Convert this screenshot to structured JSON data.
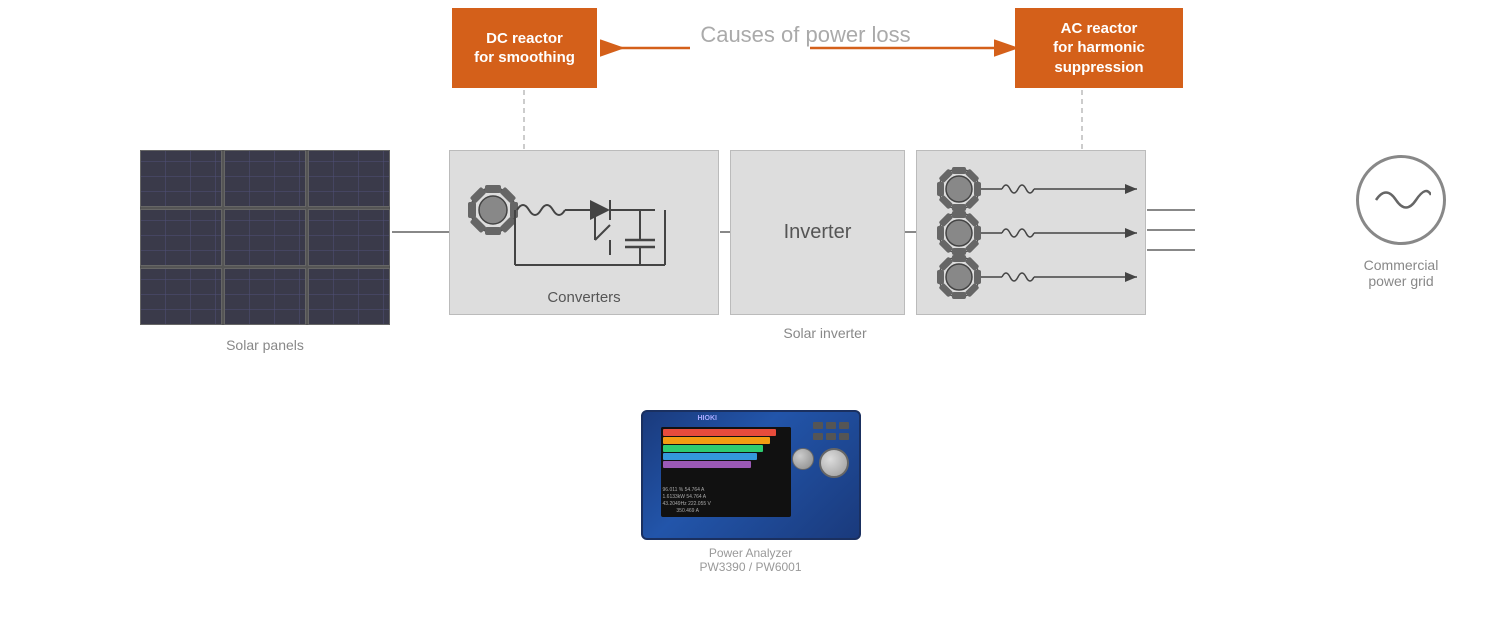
{
  "dc_reactor": {
    "label": "DC reactor\nfor smoothing",
    "line1": "DC reactor",
    "line2": "for smoothing"
  },
  "ac_reactor": {
    "label": "AC reactor for harmonic suppression",
    "line1": "AC reactor",
    "line2": "for harmonic",
    "line3": "suppression"
  },
  "causes_title": "Causes of power loss",
  "solar_panels": {
    "label": "Solar panels"
  },
  "converter": {
    "label": "Converters"
  },
  "inverter": {
    "label": "Inverter"
  },
  "solar_inverter": {
    "label": "Solar inverter"
  },
  "commercial_power_grid": {
    "label": "Commercial\npower grid",
    "line1": "Commercial",
    "line2": "power grid"
  },
  "instrument": {
    "label1": "Power Analyzer",
    "label2": "PW3390 / PW6001"
  },
  "waveforms": [
    {
      "color": "#e74c3c",
      "width": "90%"
    },
    {
      "color": "#f39c12",
      "width": "85%"
    },
    {
      "color": "#2ecc71",
      "width": "80%"
    },
    {
      "color": "#3498db",
      "width": "75%"
    },
    {
      "color": "#9b59b6",
      "width": "70%"
    }
  ]
}
